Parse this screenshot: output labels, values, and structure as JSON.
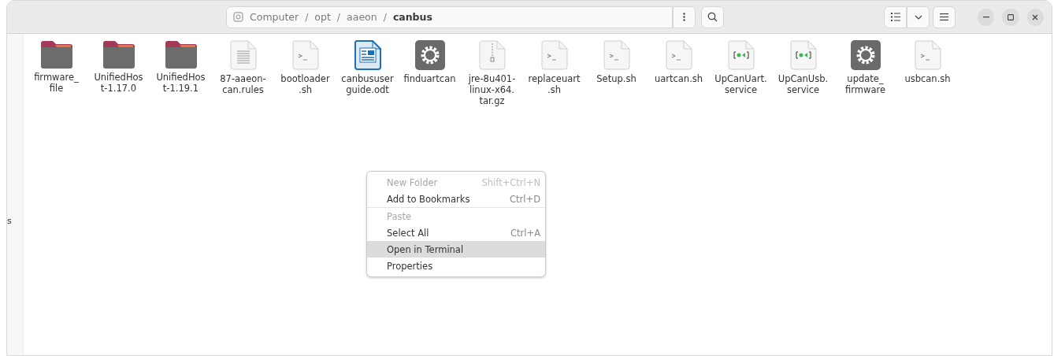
{
  "path_bar": {
    "crumbs": [
      {
        "label": "Computer",
        "current": false
      },
      {
        "label": "opt",
        "current": false
      },
      {
        "label": "aaeon",
        "current": false
      },
      {
        "label": "canbus",
        "current": true
      }
    ],
    "separator": "/"
  },
  "sidebar": {
    "fragment": "s"
  },
  "files": [
    {
      "name": "firmware_\nfile",
      "kind": "folder"
    },
    {
      "name": "UnifiedHos\nt-1.17.0",
      "kind": "folder"
    },
    {
      "name": "UnifiedHos\nt-1.19.1",
      "kind": "folder"
    },
    {
      "name": "87-aaeon-\ncan.rules",
      "kind": "text"
    },
    {
      "name": "bootloader\n.sh",
      "kind": "script"
    },
    {
      "name": "canbususer\nguide.odt",
      "kind": "document"
    },
    {
      "name": "finduartcan",
      "kind": "executable"
    },
    {
      "name": "jre-8u401-\nlinux-x64.\ntar.gz",
      "kind": "archive"
    },
    {
      "name": "replaceuart\n.sh",
      "kind": "script"
    },
    {
      "name": "Setup.sh",
      "kind": "script"
    },
    {
      "name": "uartcan.sh",
      "kind": "script"
    },
    {
      "name": "UpCanUart.\nservice",
      "kind": "service"
    },
    {
      "name": "UpCanUsb.\nservice",
      "kind": "service"
    },
    {
      "name": "update_\nfirmware",
      "kind": "executable"
    },
    {
      "name": "usbcan.sh",
      "kind": "script"
    }
  ],
  "context_menu": [
    {
      "label": "New Folder",
      "shortcut": "Shift+Ctrl+N",
      "disabled": true,
      "selected": false,
      "separator_after": false
    },
    {
      "label": "Add to Bookmarks",
      "shortcut": "Ctrl+D",
      "disabled": false,
      "selected": false,
      "separator_after": true
    },
    {
      "label": "Paste",
      "disabled": true,
      "selected": false,
      "separator_after": false
    },
    {
      "label": "Select All",
      "shortcut": "Ctrl+A",
      "disabled": false,
      "selected": false,
      "separator_after": false
    },
    {
      "label": "Open in Terminal",
      "disabled": false,
      "selected": true,
      "separator_after": false
    },
    {
      "label": "Properties",
      "disabled": false,
      "selected": false,
      "separator_after": false
    }
  ]
}
